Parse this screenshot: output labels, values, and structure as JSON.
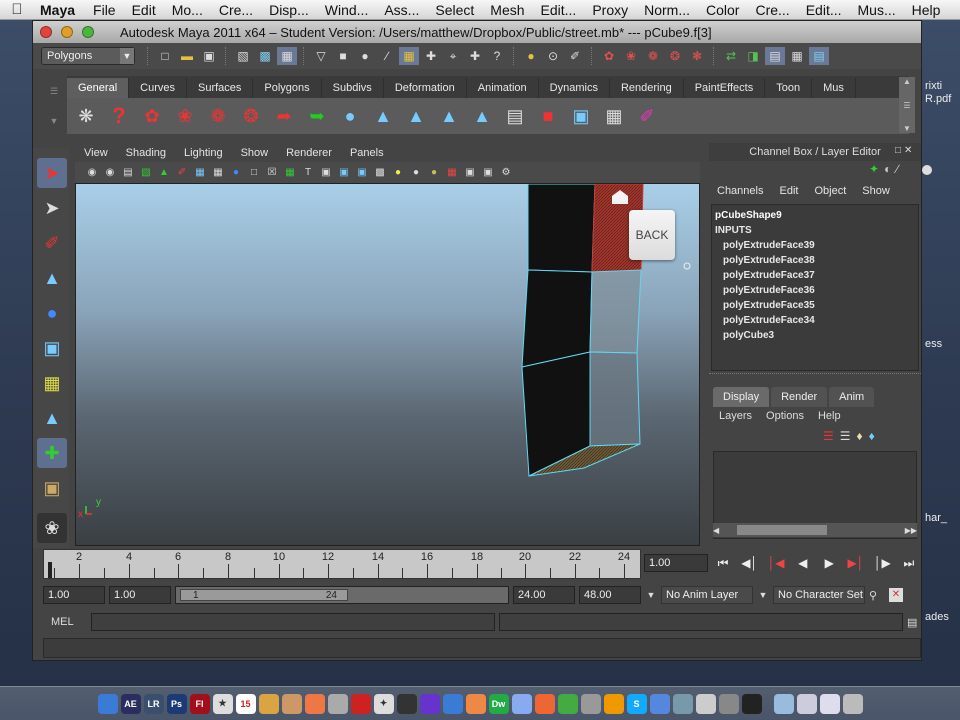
{
  "menubar": {
    "app": "Maya",
    "items": [
      "File",
      "Edit",
      "Mo...",
      "Cre...",
      "Disp...",
      "Wind...",
      "Ass...",
      "Select",
      "Mesh",
      "Edit...",
      "Proxy",
      "Norm...",
      "Color",
      "Cre...",
      "Edit...",
      "Mus...",
      "Help"
    ]
  },
  "window": {
    "title": "Autodesk Maya 2011 x64 – Student Version: /Users/matthew/Dropbox/Public/street.mb*  ---  pCube9.f[3]"
  },
  "statusline": {
    "mode": "Polygons"
  },
  "shelf": {
    "tabs": [
      "General",
      "Curves",
      "Surfaces",
      "Polygons",
      "Subdivs",
      "Deformation",
      "Animation",
      "Dynamics",
      "Rendering",
      "PaintEffects",
      "Toon",
      "Mus"
    ],
    "active_tab": "General"
  },
  "viewport": {
    "menu": [
      "View",
      "Shading",
      "Lighting",
      "Show",
      "Renderer",
      "Panels"
    ],
    "back_button": "BACK",
    "axis_x": "x",
    "axis_y": "y"
  },
  "channelbox": {
    "title": "Channel Box / Layer Editor",
    "menu": [
      "Channels",
      "Edit",
      "Object",
      "Show"
    ],
    "shape": "pCubeShape9",
    "inputs_label": "INPUTS",
    "inputs": [
      "polyExtrudeFace39",
      "polyExtrudeFace38",
      "polyExtrudeFace37",
      "polyExtrudeFace36",
      "polyExtrudeFace35",
      "polyExtrudeFace34",
      "polyCube3"
    ]
  },
  "layereditor": {
    "tabs": [
      "Display",
      "Render",
      "Anim"
    ],
    "active_tab": "Display",
    "menu": [
      "Layers",
      "Options",
      "Help"
    ]
  },
  "timeslider": {
    "labels": [
      "2",
      "4",
      "6",
      "8",
      "10",
      "12",
      "14",
      "16",
      "18",
      "20",
      "22",
      "24"
    ],
    "current_frame": "1.00"
  },
  "range": {
    "start": "1.00",
    "playback_start": "1.00",
    "slider_start": "1",
    "slider_end": "24",
    "playback_end": "24.00",
    "end": "48.00",
    "anim_layer": "No Anim Layer",
    "character_set": "No Character Set"
  },
  "commandline": {
    "label": "MEL"
  },
  "desktop": {
    "file1a": "rixti",
    "file1b": "R.pdf",
    "file2": "ess",
    "file3": "har_",
    "file4": "ades"
  },
  "dock": {
    "items": [
      "Finder",
      "AE",
      "LR",
      "Ps",
      "Fl",
      "Stickies",
      "Calendar",
      "Folder",
      "Preview",
      "Photo Booth",
      "Mail",
      "Maya",
      "Terminal",
      "Quartz",
      "Dropbox",
      "Utility",
      "Acorn",
      "Dreamweaver",
      "Messages",
      "Firefox",
      "Chrome",
      "Mirror",
      "Lock",
      "Skype",
      "iTunes",
      "Photos",
      "Remote",
      "Disk",
      "Utilities",
      "Docs",
      "Downloads",
      "Trash"
    ]
  }
}
